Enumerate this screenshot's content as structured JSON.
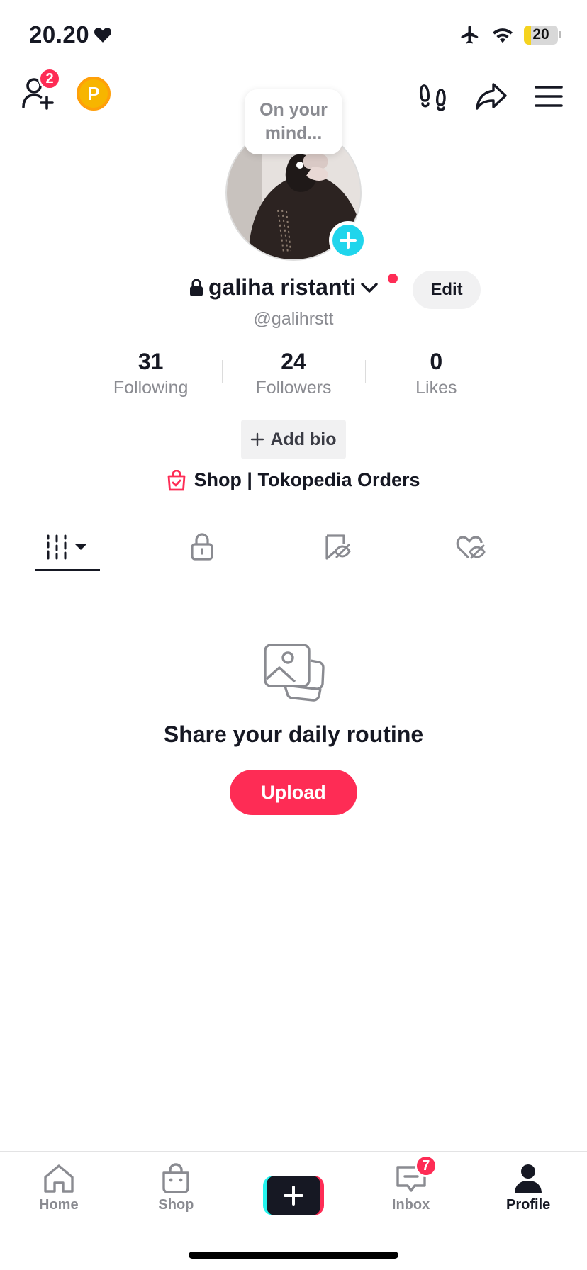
{
  "status_bar": {
    "time": "20.20",
    "battery_level": "20",
    "battery_fraction": 0.2
  },
  "top_bar": {
    "friends_badge": "2",
    "coin_letter": "P"
  },
  "profile": {
    "mind_prompt": "On your mind...",
    "display_name": "galiha ristanti",
    "username": "@galihrstt",
    "edit_label": "Edit",
    "stats": [
      {
        "value": "31",
        "label": "Following"
      },
      {
        "value": "24",
        "label": "Followers"
      },
      {
        "value": "0",
        "label": "Likes"
      }
    ],
    "add_bio_label": "Add bio",
    "shop_label": "Shop | Tokopedia Orders"
  },
  "tabs": {
    "active": "videos",
    "items": [
      "videos-grid-icon",
      "lock-icon",
      "bookmark-hidden-icon",
      "heart-hidden-icon"
    ]
  },
  "empty_state": {
    "title": "Share your daily routine",
    "upload_label": "Upload"
  },
  "bottom_nav": {
    "home": "Home",
    "shop": "Shop",
    "inbox": "Inbox",
    "inbox_badge": "7",
    "profile": "Profile"
  },
  "colors": {
    "accent": "#fe2c55",
    "cyan": "#20d5ec",
    "text": "#161823",
    "muted": "#8a8b91"
  }
}
